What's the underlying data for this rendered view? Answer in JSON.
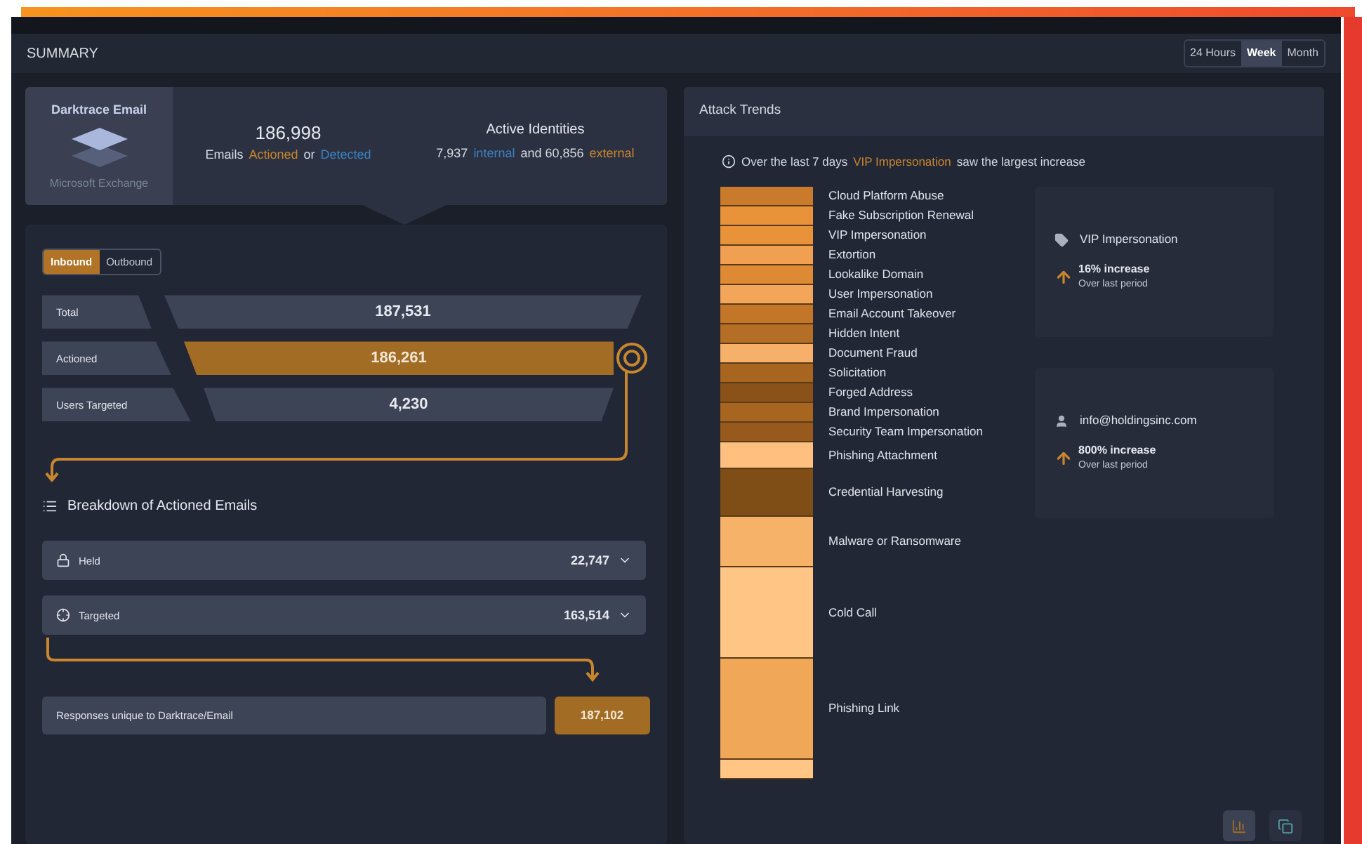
{
  "header": {
    "title": "SUMMARY",
    "ranges": [
      {
        "label": "24 Hours",
        "selected": false
      },
      {
        "label": "Week",
        "selected": true
      },
      {
        "label": "Month",
        "selected": false
      }
    ]
  },
  "overview": {
    "product": "Darktrace Email",
    "platform": "Microsoft Exchange",
    "emails_count": "186,998",
    "emails_caption": [
      {
        "text": "Emails",
        "kind": "plain"
      },
      {
        "text": "Actioned",
        "kind": "actioned"
      },
      {
        "text": "or",
        "kind": "plain"
      },
      {
        "text": "Detected",
        "kind": "detected"
      }
    ],
    "identities_title": "Active Identities",
    "identities_caption": [
      {
        "text": "7,937",
        "kind": "plain"
      },
      {
        "text": "internal",
        "kind": "detected"
      },
      {
        "text": "and 60,856",
        "kind": "plain"
      },
      {
        "text": "external",
        "kind": "actioned"
      }
    ]
  },
  "directions": [
    {
      "label": "Inbound",
      "selected": true
    },
    {
      "label": "Outbound",
      "selected": false
    }
  ],
  "funnel": [
    {
      "label": "Total",
      "value": "187,531",
      "highlighted": false
    },
    {
      "label": "Actioned",
      "value": "186,261",
      "highlighted": true
    },
    {
      "label": "Users Targeted",
      "value": "4,230",
      "highlighted": false
    }
  ],
  "breakdown": {
    "title": "Breakdown of Actioned Emails",
    "items": [
      {
        "kind": "lock",
        "label": "Held",
        "value": "22,747"
      },
      {
        "kind": "target",
        "label": "Targeted",
        "value": "163,514"
      }
    ]
  },
  "unique": {
    "label": "Responses unique to Darktrace/Email",
    "value": "187,102"
  },
  "attack_trends": {
    "title": "Attack Trends",
    "note": [
      {
        "text": "Over the last 7 days",
        "kind": "plain"
      },
      {
        "text": "VIP Impersonation",
        "kind": "actioned"
      },
      {
        "text": "saw the largest increase",
        "kind": "plain"
      }
    ],
    "categories": [
      {
        "label": "Cloud Platform Abuse",
        "color": "#c97a2a"
      },
      {
        "label": "Fake Subscription Renewal",
        "color": "#e8923a"
      },
      {
        "label": "VIP Impersonation",
        "color": "#e8923a"
      },
      {
        "label": "Extortion",
        "color": "#f0a050"
      },
      {
        "label": "Lookalike Domain",
        "color": "#de8a35"
      },
      {
        "label": "User Impersonation",
        "color": "#f3a65a"
      },
      {
        "label": "Email Account Takeover",
        "color": "#c47628"
      },
      {
        "label": "Hidden Intent",
        "color": "#b56e25"
      },
      {
        "label": "Document Fraud",
        "color": "#f7b06a"
      },
      {
        "label": "Solicitation",
        "color": "#a8651f"
      },
      {
        "label": "Forged Address",
        "color": "#8a5219"
      },
      {
        "label": "Brand Impersonation",
        "color": "#a8651f"
      },
      {
        "label": "Security Team Impersonation",
        "color": "#97591c"
      },
      {
        "label": "Phishing Attachment",
        "color": "#ffc07f"
      },
      {
        "label": "Credential Harvesting",
        "color": "#7f4d16"
      },
      {
        "label": "Malware or Ransomware",
        "color": "#f7b26a"
      },
      {
        "label": "Cold Call",
        "color": "#ffc584"
      },
      {
        "label": "Phishing Link",
        "color": "#f0a858"
      },
      {
        "color": "#ffc584"
      }
    ],
    "highlights": [
      {
        "kind": "tag",
        "name": "VIP Impersonation",
        "change": "16% increase",
        "caption": "Over last period"
      },
      {
        "kind": "user",
        "name": "info@holdingsinc.com",
        "change": "800% increase",
        "caption": "Over last period"
      }
    ],
    "view_buttons": [
      {
        "kind": "chart",
        "selected": true
      },
      {
        "kind": "split",
        "selected": false
      }
    ]
  }
}
